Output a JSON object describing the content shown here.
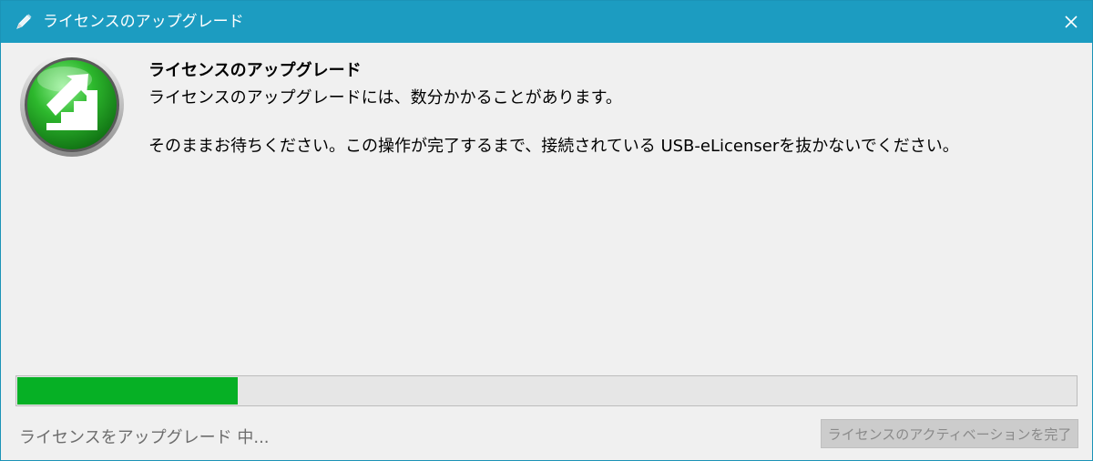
{
  "window": {
    "title": "ライセンスのアップグレード"
  },
  "content": {
    "heading": "ライセンスのアップグレード",
    "line1": "ライセンスのアップグレードには、数分かかることがあります。",
    "line2": "そのままお待ちください。この操作が完了するまで、接続されている USB-eLicenserを抜かないでください。"
  },
  "progress": {
    "fraction": 0.21
  },
  "status": {
    "text": "ライセンスをアップグレード 中..."
  },
  "buttons": {
    "finish_label": "ライセンスのアクティベーションを完了",
    "finish_enabled": false
  },
  "icons": {
    "title_icon": "pencil-icon",
    "close_icon": "close-icon",
    "app_icon": "upgrade-stairs-icon"
  },
  "colors": {
    "titlebar": "#1c9cc1",
    "progress_fill": "#06b025",
    "icon_green": "#2db82d"
  }
}
